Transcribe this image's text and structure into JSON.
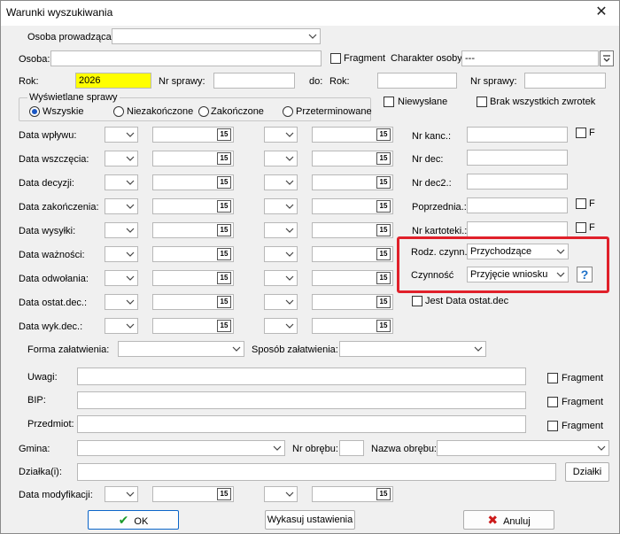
{
  "window": {
    "title": "Warunki wyszukiwania",
    "close_glyph": "✕"
  },
  "top": {
    "osoba_prowadzaca_label": "Osoba prowadząca :",
    "osoba_label": "Osoba:",
    "fragment_label": "Fragment",
    "charakter_label": "Charakter osoby:",
    "charakter_value": "---",
    "rok_label": "Rok:",
    "rok_value": "2026",
    "nr_sprawy_label": "Nr sprawy:",
    "do_label": "do:",
    "rok2_label": "Rok:",
    "nr_sprawy2_label": "Nr sprawy:"
  },
  "wyswietlane": {
    "legend": "Wyświetlane sprawy",
    "options": [
      "Wszyskie",
      "Niezakończone",
      "Zakończone",
      "Przeterminowane"
    ],
    "selected_index": 0,
    "niewyslane_label": "Niewysłane",
    "brak_zwrotek_label": "Brak wszystkich zwrotek"
  },
  "date_rows": [
    "Data wpływu:",
    "Data wszczęcia:",
    "Data decyzji:",
    "Data zakończenia:",
    "Data wysyłki:",
    "Data ważności:",
    "Data odwołania:",
    "Data ostat.dec.:",
    "Data wyk.dec.:"
  ],
  "calendar_glyph": "15",
  "right_fields": {
    "nr_kanc": "Nr kanc.:",
    "nr_dec": "Nr dec:",
    "nr_dec2": "Nr dec2.:",
    "poprzednia": "Poprzednia.:",
    "nr_kartoteki": "Nr kartoteki.:",
    "f_label": "F",
    "rodz_label": "Rodz. czynn.",
    "rodz_value": "Przychodzące",
    "czynnosc_label": "Czynność",
    "czynnosc_value": "Przyjęcie wniosku",
    "help_glyph": "?",
    "jest_data_label": "Jest Data ostat.dec"
  },
  "lower": {
    "forma_label": "Forma załatwienia:",
    "sposob_label": "Sposób załatwienia:",
    "uwagi_label": "Uwagi:",
    "bip_label": "BIP:",
    "przedmiot_label": "Przedmiot:",
    "fragment_label": "Fragment",
    "gmina_label": "Gmina:",
    "nr_obrebu_label": "Nr obrębu:",
    "nazwa_obrebu_label": "Nazwa obrębu:",
    "dzialki_label": "Działka(i):",
    "dzialki_button": "Działki",
    "data_mod_label": "Data modyfikacji:"
  },
  "buttons": {
    "ok": "OK",
    "reset": "Wykasuj ustawienia",
    "cancel": "Anuluj"
  },
  "colors": {
    "highlight": "#ffff00",
    "accent": "#1a57c4",
    "red_frame": "#e0202a"
  }
}
